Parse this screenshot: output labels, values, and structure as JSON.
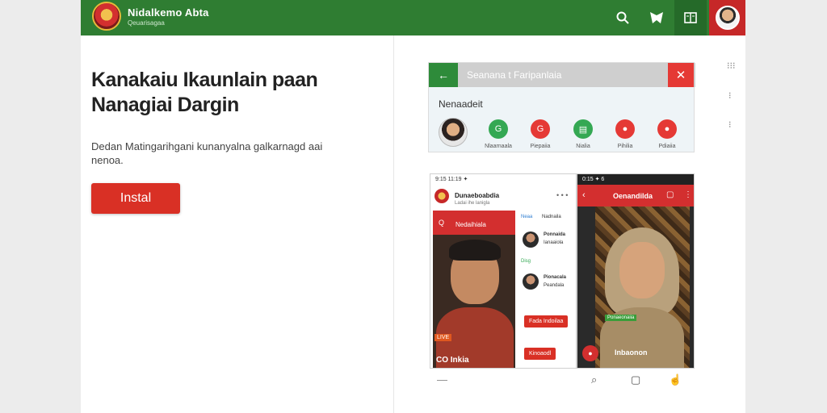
{
  "header": {
    "brand_name": "Nidalkemo Abta",
    "brand_subtitle": "Qeuarisagaa",
    "icons": [
      "search-icon",
      "bookmark-icon",
      "book-icon"
    ]
  },
  "hero": {
    "headline": "Kanakaiu Ikaunlain paan Nanagiai Dargin",
    "description": "Dedan Matingarihgani kunanyalna galkarnagd aai nenoa.",
    "install_label": "Instal"
  },
  "panel": {
    "title": "Seanana t Faripanlaia",
    "section_label": "Nenaadeit",
    "shortcuts": [
      {
        "label": "Nlaarnaala",
        "color": "#34a853",
        "icon": "G"
      },
      {
        "label": "Piepaiia",
        "color": "#e53935",
        "icon": "G"
      },
      {
        "label": "Nialia",
        "color": "#34a853",
        "icon": "▤"
      },
      {
        "label": "Pihilia",
        "color": "#e53935",
        "icon": "●"
      },
      {
        "label": "Pdiaiia",
        "color": "#e53935",
        "icon": "●"
      }
    ]
  },
  "phone1": {
    "status": "9:15 11:19 ✦",
    "app_name": "Dunaeboabdia",
    "app_sub": "Ladai ihe lanigla",
    "video_bar": "Nedaihiala",
    "live_tag": "LIVE",
    "video_caption": "CO Inkia",
    "list": {
      "tab1": "Neaa",
      "tab2": "Nadnaila",
      "row1_name": "Ponnaida",
      "row1_sub": "Ianaaiola",
      "row2_label": "Disg",
      "row3_name": "Pionacala",
      "row3_sub": "Peandala",
      "button1": "Fada Indoilaa",
      "button2": "Kinoaodl"
    }
  },
  "phone2": {
    "status": "0:15 ✦ 6",
    "title": "Oenandilda",
    "tag": "Ponaeonaiia",
    "caption": "Inbaonon"
  },
  "accent": {
    "green": "#2f7d32",
    "red": "#d93025"
  }
}
